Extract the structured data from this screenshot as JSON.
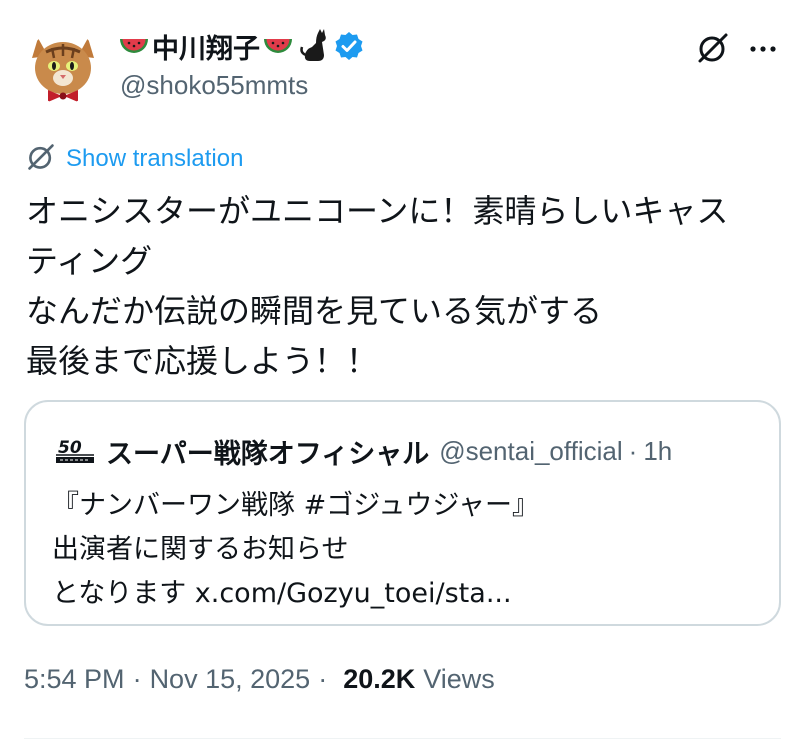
{
  "author": {
    "display_name": "中川翔子",
    "handle": "@shoko55mmts",
    "name_emoji_left": "watermelon-icon",
    "name_emoji_right": "watermelon-icon",
    "name_emoji_cat": "black-cat-icon",
    "verified": true
  },
  "translate": {
    "label": "Show translation"
  },
  "tweet": {
    "lines": [
      "オニシスターがユニコーンに！素晴らしいキャス",
      "ティング",
      "なんだか伝説の瞬間を見ている気がする",
      "最後まで応援しよう！！"
    ]
  },
  "quote": {
    "name": "スーパー戦隊オフィシャル",
    "handle": "@sentai_official",
    "separator": "·",
    "time": "1h",
    "lines": [
      "『ナンバーワン戦隊 #ゴジュウジャー』",
      "出演者に関するお知らせ",
      "となります x.com/Gozyu_toei/sta..."
    ]
  },
  "meta": {
    "time": "5:54 PM",
    "date": "Nov 15, 2025",
    "separator": "·",
    "views_count": "20.2K",
    "views_label": "Views"
  },
  "colors": {
    "link_blue": "#1d9bf0",
    "secondary_text": "#536471",
    "primary_text": "#0f1419",
    "border": "#cfd9de"
  }
}
